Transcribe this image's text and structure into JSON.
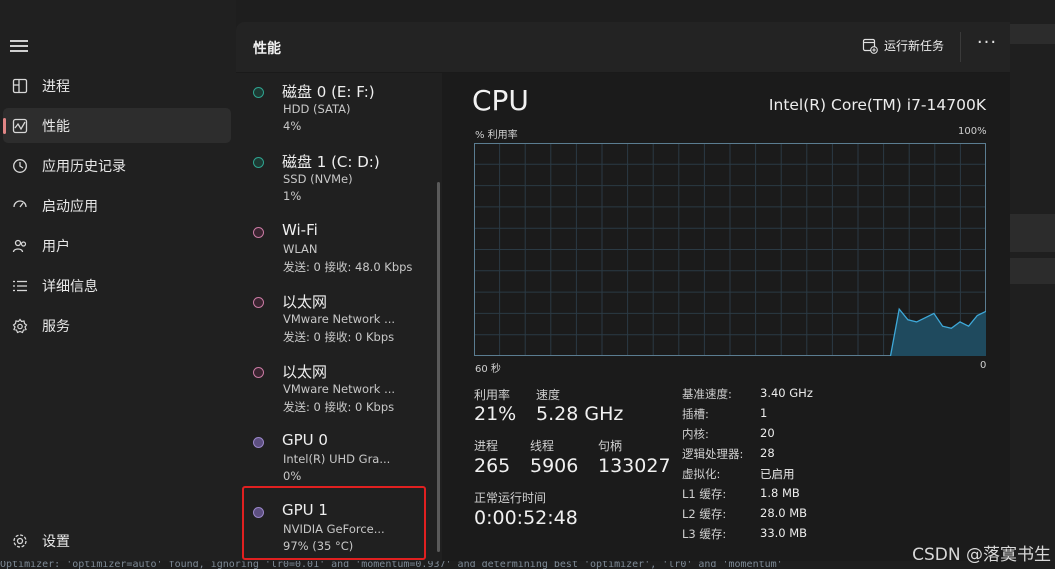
{
  "nav": {
    "items": [
      {
        "label": "进程",
        "icon": "processes-icon"
      },
      {
        "label": "性能",
        "icon": "performance-icon",
        "active": true
      },
      {
        "label": "应用历史记录",
        "icon": "app-history-icon"
      },
      {
        "label": "启动应用",
        "icon": "startup-apps-icon"
      },
      {
        "label": "用户",
        "icon": "users-icon"
      },
      {
        "label": "详细信息",
        "icon": "details-icon"
      },
      {
        "label": "服务",
        "icon": "services-icon"
      }
    ],
    "settings_label": "设置"
  },
  "header": {
    "title": "性能",
    "run_task_label": "运行新任务",
    "more_label": "···"
  },
  "devices": [
    {
      "name": "磁盘 0 (E: F:)",
      "sub": "HDD (SATA)",
      "value": "4%",
      "color": "#2fa38f"
    },
    {
      "name": "磁盘 1 (C: D:)",
      "sub": "SSD (NVMe)",
      "value": "1%",
      "color": "#2fa38f"
    },
    {
      "name": "Wi-Fi",
      "sub": "WLAN",
      "value": "发送: 0 接收: 48.0 Kbps",
      "color": "#c97aa3"
    },
    {
      "name": "以太网",
      "sub": "VMware Network ...",
      "value": "发送: 0 接收: 0 Kbps",
      "color": "#c97aa3"
    },
    {
      "name": "以太网",
      "sub": "VMware Network ...",
      "value": "发送: 0 接收: 0 Kbps",
      "color": "#c97aa3"
    },
    {
      "name": "GPU 0",
      "sub": "Intel(R) UHD Gra...",
      "value": "0%",
      "color": "#9a86c9"
    },
    {
      "name": "GPU 1",
      "sub": "NVIDIA GeForce...",
      "value": "97% (35 °C)",
      "color": "#9a86c9"
    }
  ],
  "cpu": {
    "title": "CPU",
    "model": "Intel(R) Core(TM) i7-14700K",
    "graph_ylabel": "% 利用率",
    "graph_ymax": "100%",
    "graph_xlabel": "60 秒",
    "graph_xmin": "0",
    "stats": {
      "utilization_label": "利用率",
      "utilization": "21%",
      "speed_label": "速度",
      "speed": "5.28 GHz",
      "processes_label": "进程",
      "processes": "265",
      "threads_label": "线程",
      "threads": "5906",
      "handles_label": "句柄",
      "handles": "133027",
      "uptime_label": "正常运行时间",
      "uptime": "0:00:52:48"
    },
    "specs": [
      {
        "label": "基准速度:",
        "value": "3.40 GHz"
      },
      {
        "label": "插槽:",
        "value": "1"
      },
      {
        "label": "内核:",
        "value": "20"
      },
      {
        "label": "逻辑处理器:",
        "value": "28"
      },
      {
        "label": "虚拟化:",
        "value": "已启用"
      },
      {
        "label": "L1 缓存:",
        "value": "1.8 MB"
      },
      {
        "label": "L2 缓存:",
        "value": "28.0 MB"
      },
      {
        "label": "L3 缓存:",
        "value": "33.0 MB"
      }
    ],
    "usage_history": [
      0,
      0,
      0,
      0,
      0,
      0,
      0,
      0,
      0,
      0,
      0,
      0,
      0,
      0,
      0,
      0,
      0,
      0,
      0,
      0,
      0,
      0,
      0,
      0,
      0,
      0,
      0,
      0,
      0,
      0,
      0,
      0,
      0,
      0,
      0,
      0,
      0,
      0,
      0,
      0,
      0,
      0,
      0,
      0,
      0,
      0,
      0,
      0,
      0,
      22,
      17,
      16,
      18,
      20,
      14,
      13,
      16,
      14,
      19,
      21
    ]
  },
  "footer": {
    "console_text": "Optimizer: 'optimizer=auto' found, ignoring 'lr0=0.01' and 'momentum=0.937' and determining best 'optimizer', 'lr0' and 'momentum'",
    "watermark": "CSDN @落寞书生"
  },
  "colors": {
    "accent": "#e08585",
    "graph_line": "#3ea8d8",
    "graph_fill": "#1f4a5e",
    "highlight": "#e02020"
  }
}
